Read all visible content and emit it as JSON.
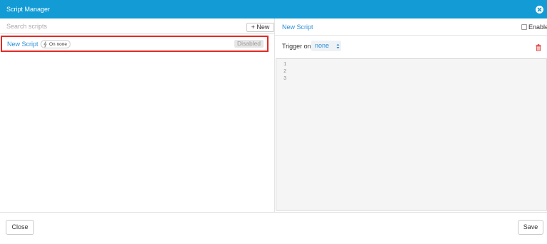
{
  "window": {
    "title": "Script Manager",
    "close_icon": "close-circle-icon",
    "accent": "#129bd4"
  },
  "sidebar": {
    "search_placeholder": "Search scripts",
    "new_label": "+ New",
    "scripts": [
      {
        "name": "New Script",
        "trigger": "On none",
        "status": "Disabled",
        "selected": true
      }
    ]
  },
  "detail": {
    "script_name": "New Script",
    "enable_label": "Enable",
    "enabled": false,
    "trigger_label": "Trigger on",
    "trigger_value": "none",
    "delete_icon": "trash-icon",
    "delete_color": "#e23c3c",
    "line_numbers": [
      "1",
      "2",
      "3"
    ]
  },
  "footer": {
    "close_label": "Close",
    "save_label": "Save"
  }
}
